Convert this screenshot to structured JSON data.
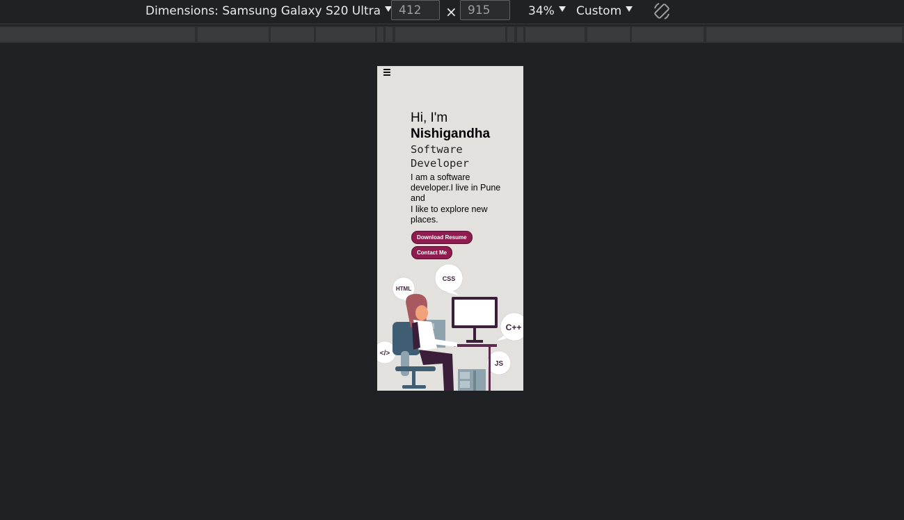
{
  "toolbar": {
    "dimensions_label": "Dimensions: Samsung Galaxy S20 Ultra",
    "width": "412",
    "height": "915",
    "times": "×",
    "zoom": "34%",
    "throttle": "Custom"
  },
  "page": {
    "menu_icon": "hamburger-icon",
    "greeting": "Hi, I'm",
    "name": "Nishigandha",
    "role_line1": "Software",
    "role_line2": "Developer",
    "bio": "I am a software developer.I live in Pune and\nI like to explore new places.",
    "download_button": "Download Resume",
    "contact_button": "Contact Me",
    "accent_color": "#8e1c4f",
    "bubbles": {
      "html": "HTML",
      "css": "CSS",
      "cpp": "C++",
      "code": "</>",
      "js": "JS"
    }
  }
}
